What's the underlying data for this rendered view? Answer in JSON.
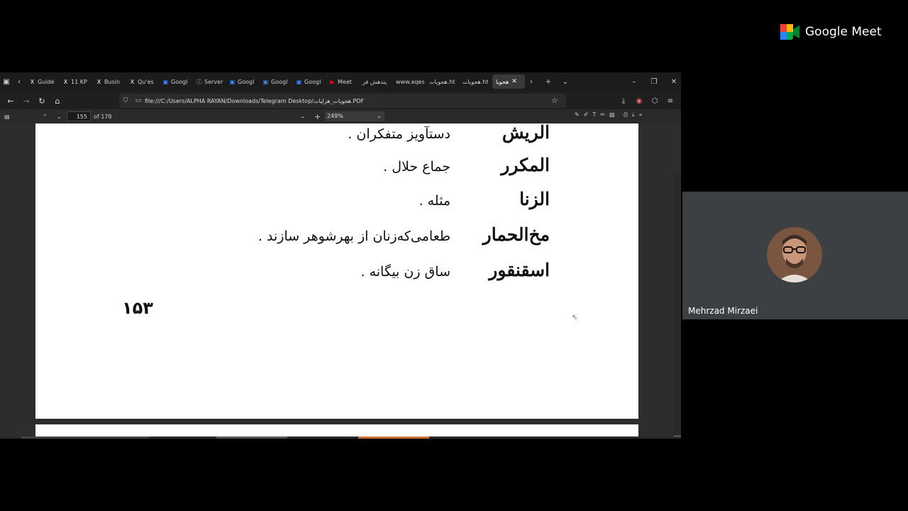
{
  "browser": {
    "tabs": [
      {
        "label": "Guide",
        "icon": "x-icon",
        "color": "#ffffff"
      },
      {
        "label": "11 KP",
        "icon": "x-icon",
        "color": "#ffffff"
      },
      {
        "label": "Busin",
        "icon": "x-icon",
        "color": "#ffffff"
      },
      {
        "label": "Qu'es",
        "icon": "x-icon",
        "color": "#ffffff"
      },
      {
        "label": "Googl",
        "icon": "google-icon",
        "color": "#4285f4"
      },
      {
        "label": "Server",
        "icon": "info-icon",
        "color": "#cccccc"
      },
      {
        "label": "Googl",
        "icon": "google-icon",
        "color": "#4285f4"
      },
      {
        "label": "Googl",
        "icon": "google-icon",
        "color": "#4285f4"
      },
      {
        "label": "Googl",
        "icon": "google-icon",
        "color": "#4285f4"
      },
      {
        "label": "Meet",
        "icon": "youtube-icon",
        "color": "#ff0000"
      },
      {
        "label": "پندهش فر",
        "icon": "",
        "color": ""
      },
      {
        "label": "www.aqes",
        "icon": "",
        "color": ""
      },
      {
        "label": "هجویات.ht",
        "icon": "",
        "color": ""
      },
      {
        "label": "هجویات.ht",
        "icon": "",
        "color": ""
      }
    ],
    "active_tab": "هجویا",
    "url": "file:///C:/Users/ALPHA RAYAN/Downloads/Telegram Desktop/هجویات_هزلیات.PDF"
  },
  "pdf_toolbar": {
    "page_number": "155",
    "page_total": "of 178",
    "zoom": "249%"
  },
  "document": {
    "entries": [
      {
        "term": "الریش",
        "definition": "دستآویز متفکران ."
      },
      {
        "term": "المکرر",
        "definition": "جماع حلال ."
      },
      {
        "term": "الزنا",
        "definition": "مثله ."
      },
      {
        "term": "مخ‌الحمار",
        "definition": "طعامی‌که‌زنان از بهرشوهر سازند ."
      },
      {
        "term": "اسقنقور",
        "definition": "ساق زن بیگانه ."
      }
    ],
    "page_number": "۱۵۳"
  },
  "meet": {
    "brand": "Google Meet",
    "participant_name": "Mehrzad Mirzaei"
  }
}
